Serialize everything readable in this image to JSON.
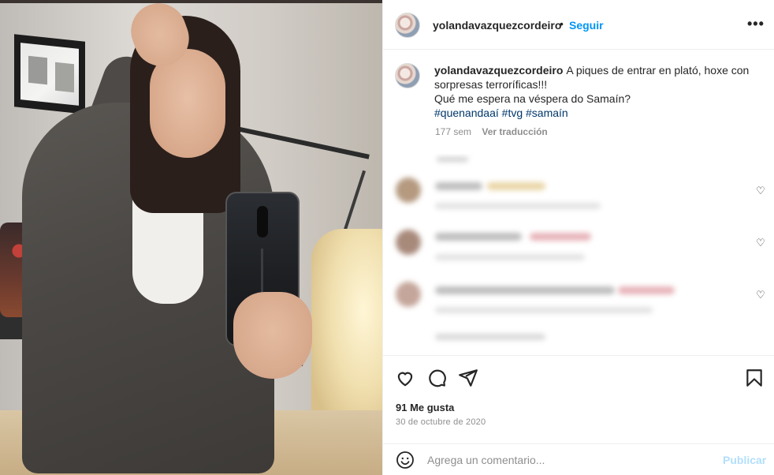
{
  "post": {
    "author": "yolandavazquezcordeiro",
    "follow_label": "Seguir",
    "separator": "•",
    "more_label": "•••",
    "caption": {
      "username": "yolandavazquezcordeiro",
      "line1": "A piques de entrar en plató, hoxe con sorpresas terroríficas!!!",
      "line2": "Qué me espera na véspera do Samaín?",
      "hashtags": [
        "#quenandaaí",
        "#tvg",
        "#samaín"
      ],
      "age": "177 sem",
      "translate_label": "Ver traducción"
    },
    "likes": "91 Me gusta",
    "date": "30 de octubre de 2020",
    "add_comment_placeholder": "Agrega un comentario...",
    "publish_label": "Publicar"
  },
  "icons": {
    "like": "heart-icon",
    "comment": "comment-icon",
    "share": "share-icon",
    "save": "bookmark-icon",
    "emoji": "emoji-icon",
    "more": "more-icon"
  },
  "colors": {
    "follow": "#0095f6",
    "hashtag": "#00376b",
    "muted": "#8e8e8e",
    "publish_disabled": "#b2dffc"
  }
}
